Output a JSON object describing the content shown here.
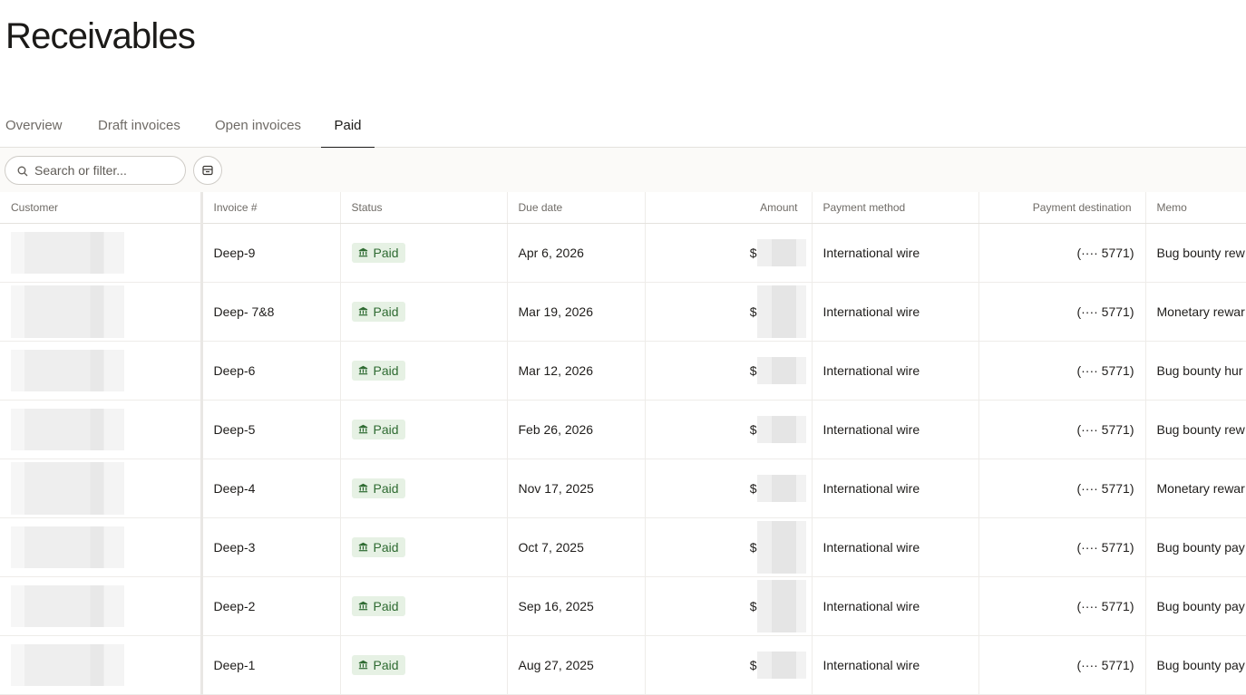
{
  "page": {
    "title": "Receivables"
  },
  "tabs": [
    {
      "label": "Overview",
      "active": false
    },
    {
      "label": "Draft invoices",
      "active": false
    },
    {
      "label": "Open invoices",
      "active": false
    },
    {
      "label": "Paid",
      "active": true
    }
  ],
  "search": {
    "placeholder": "Search or filter..."
  },
  "table": {
    "columns": {
      "customer": "Customer",
      "invoice": "Invoice #",
      "status": "Status",
      "due_date": "Due date",
      "amount": "Amount",
      "payment_method": "Payment method",
      "payment_destination": "Payment destination",
      "memo": "Memo"
    },
    "rows": [
      {
        "invoice": "Deep-9",
        "status": "Paid",
        "due_date": "Apr 6, 2026",
        "amount_prefix": "$",
        "payment_method": "International wire",
        "payment_destination": "(···· 5771)",
        "memo": "Bug bounty rew"
      },
      {
        "invoice": "Deep- 7&8",
        "status": "Paid",
        "due_date": "Mar 19, 2026",
        "amount_prefix": "$",
        "payment_method": "International wire",
        "payment_destination": "(···· 5771)",
        "memo": "Monetary rewar"
      },
      {
        "invoice": "Deep-6",
        "status": "Paid",
        "due_date": "Mar 12, 2026",
        "amount_prefix": "$",
        "payment_method": "International wire",
        "payment_destination": "(···· 5771)",
        "memo": "Bug bounty hur"
      },
      {
        "invoice": "Deep-5",
        "status": "Paid",
        "due_date": "Feb 26, 2026",
        "amount_prefix": "$",
        "payment_method": "International wire",
        "payment_destination": "(···· 5771)",
        "memo": "Bug bounty rew"
      },
      {
        "invoice": "Deep-4",
        "status": "Paid",
        "due_date": "Nov 17, 2025",
        "amount_prefix": "$",
        "payment_method": "International wire",
        "payment_destination": "(···· 5771)",
        "memo": "Monetary rewar"
      },
      {
        "invoice": "Deep-3",
        "status": "Paid",
        "due_date": "Oct 7, 2025",
        "amount_prefix": "$",
        "payment_method": "International wire",
        "payment_destination": "(···· 5771)",
        "memo": "Bug bounty pay"
      },
      {
        "invoice": "Deep-2",
        "status": "Paid",
        "due_date": "Sep 16, 2025",
        "amount_prefix": "$",
        "payment_method": "International wire",
        "payment_destination": "(···· 5771)",
        "memo": "Bug bounty pay"
      },
      {
        "invoice": "Deep-1",
        "status": "Paid",
        "due_date": "Aug 27, 2025",
        "amount_prefix": "$",
        "payment_method": "International wire",
        "payment_destination": "(···· 5771)",
        "memo": "Bug bounty pay"
      }
    ]
  },
  "colors": {
    "paid_badge_bg": "#e6f1e4",
    "paid_badge_text": "#2f6b32"
  },
  "icons": {
    "search": "search-icon",
    "filter": "filter-table-icon",
    "paid": "bank-icon"
  }
}
